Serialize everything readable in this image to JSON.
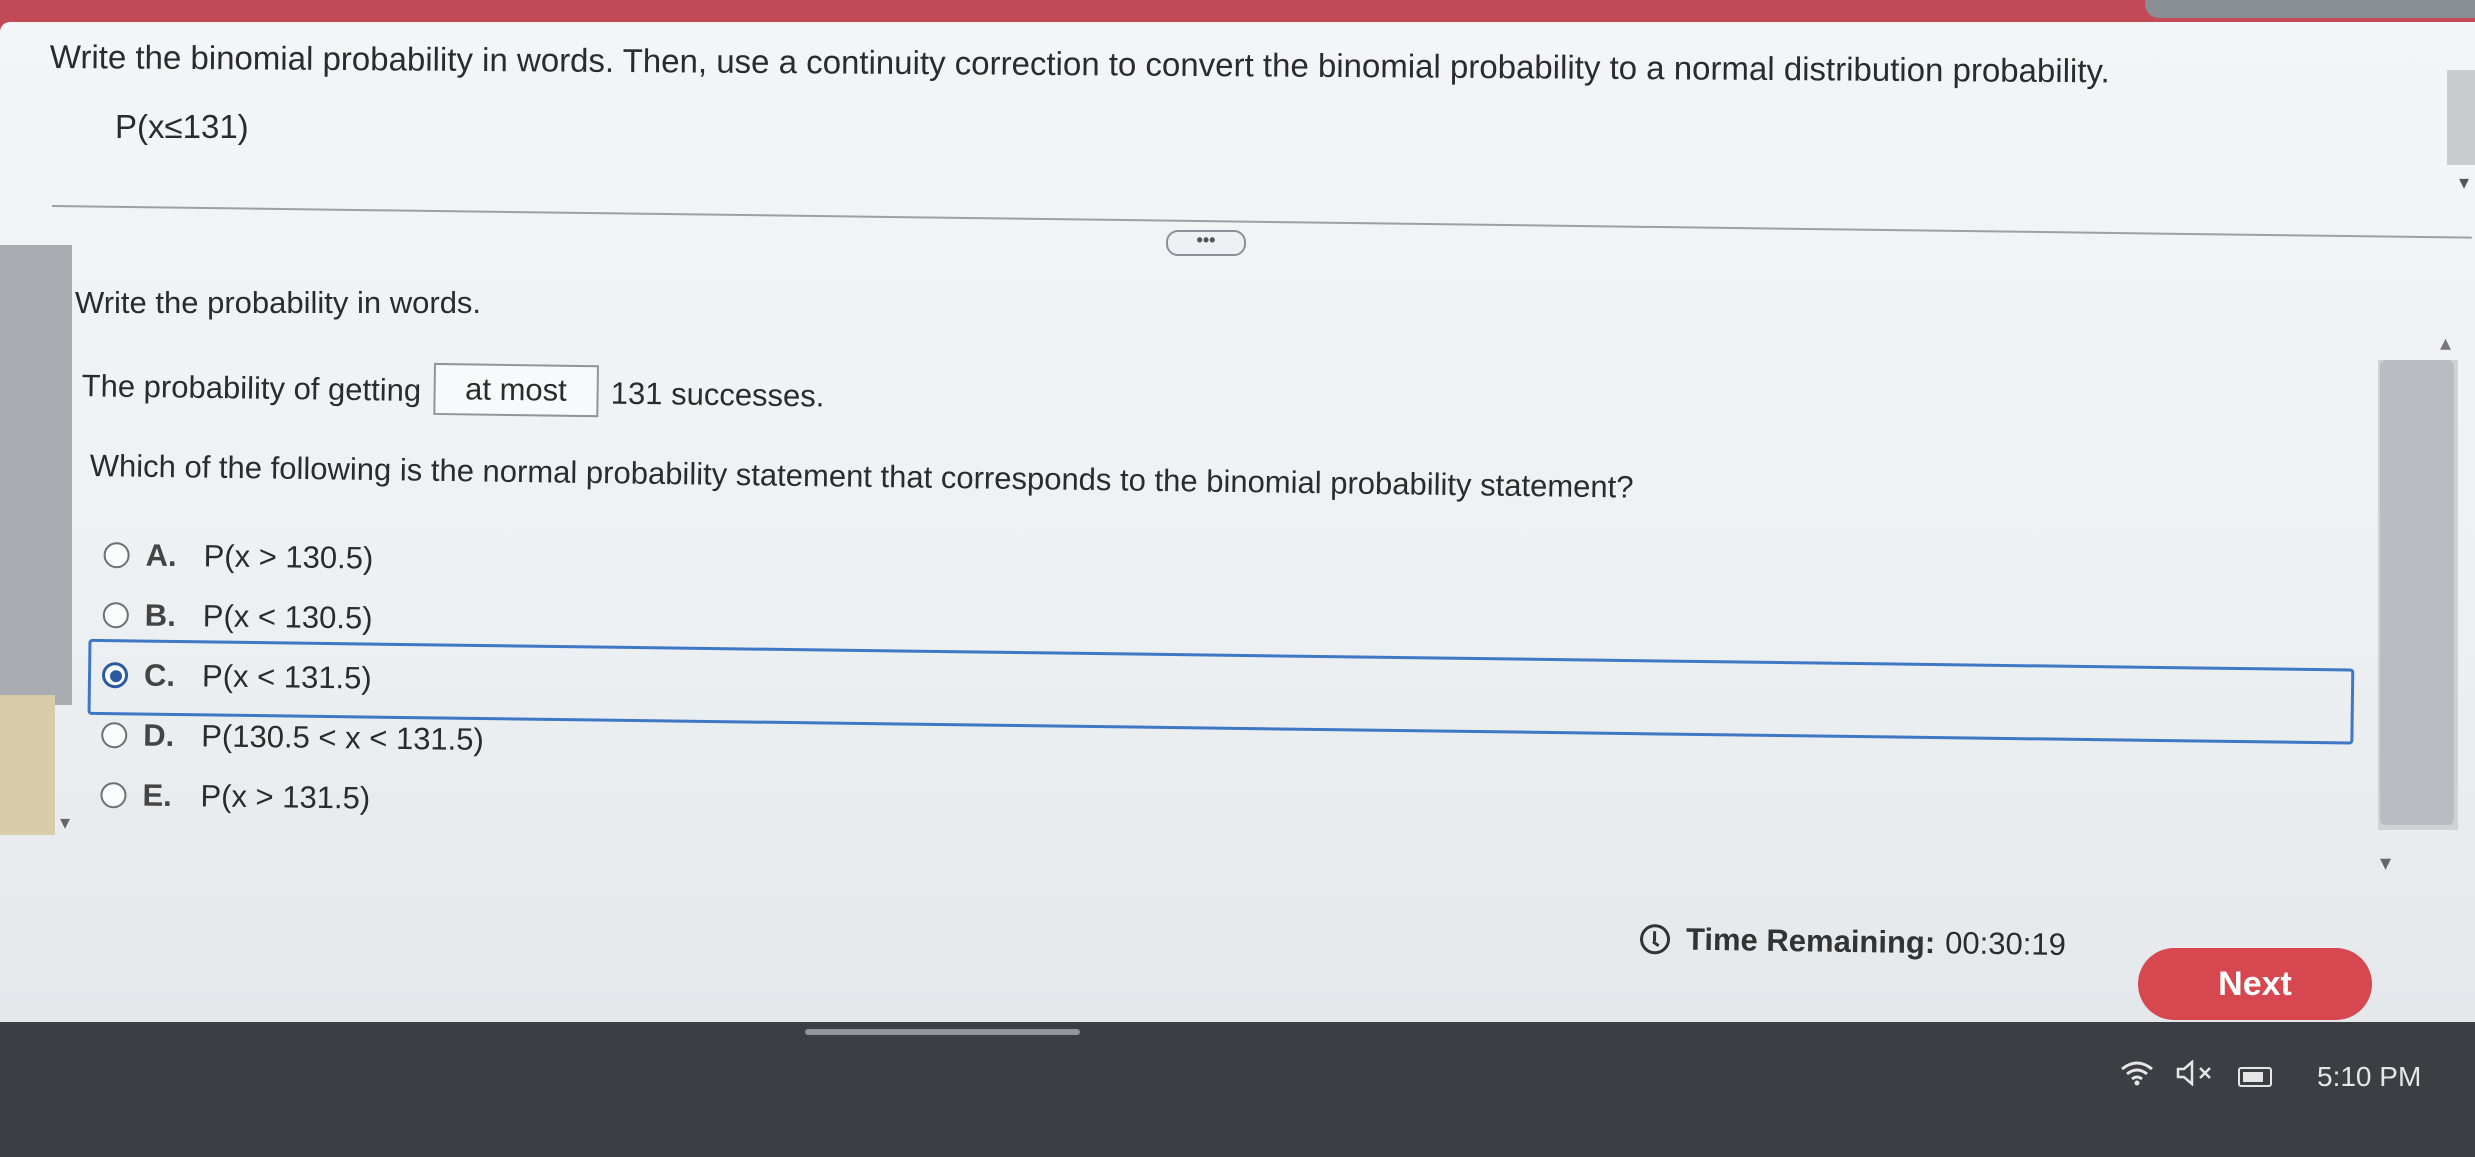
{
  "question": {
    "text": "Write the binomial probability in words. Then, use a continuity correction to convert the binomial probability to a normal distribution probability.",
    "expression": "P(x≤131)",
    "expand_label": "•••"
  },
  "words": {
    "label": "Write the probability in words.",
    "sentence_prefix": "The probability of getting",
    "answer": "at most",
    "sentence_suffix": "131 successes."
  },
  "mcq": {
    "prompt": "Which of the following is the normal probability statement that corresponds to the binomial probability statement?",
    "options": [
      {
        "letter": "A.",
        "text": "P(x > 130.5)"
      },
      {
        "letter": "B.",
        "text": "P(x < 130.5)"
      },
      {
        "letter": "C.",
        "text": "P(x < 131.5)"
      },
      {
        "letter": "D.",
        "text": "P(130.5 < x < 131.5)"
      },
      {
        "letter": "E.",
        "text": "P(x > 131.5)"
      }
    ],
    "selected_index": 2
  },
  "footer": {
    "timer_label": "Time Remaining:",
    "timer_value": "00:30:19",
    "next_label": "Next"
  },
  "taskbar": {
    "time": "5:10 PM",
    "icons": [
      "wifi-icon",
      "speaker-muted-icon",
      "battery-icon"
    ]
  }
}
